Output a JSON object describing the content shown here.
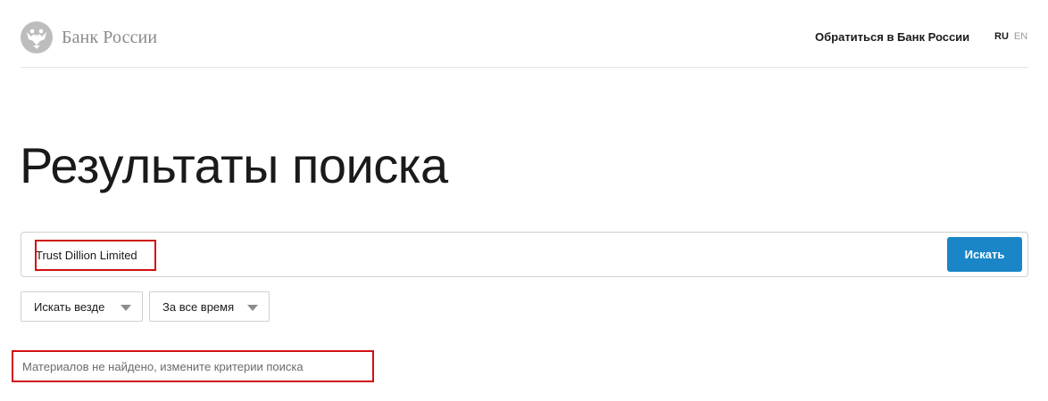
{
  "header": {
    "logo_text": "Банк России",
    "contact_link": "Обратиться в Банк России",
    "lang_ru": "RU",
    "lang_en": "EN"
  },
  "main": {
    "title": "Результаты поиска"
  },
  "search": {
    "value": "Trust Dillion Limited",
    "button_label": "Искать"
  },
  "filters": {
    "where": "Искать везде",
    "time": "За все время"
  },
  "results": {
    "message": "Материалов не найдено, измените критерии поиска"
  },
  "colors": {
    "accent": "#1a86c8",
    "highlight": "#d01010"
  },
  "icons": {
    "logo": "double-headed-eagle-emblem",
    "dropdown": "chevron-down-icon"
  }
}
